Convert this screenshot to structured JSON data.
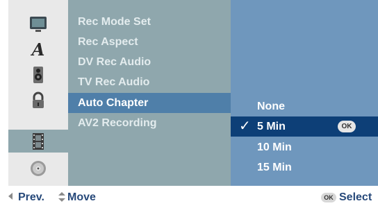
{
  "icons": [
    {
      "name": "tv-screen-icon"
    },
    {
      "name": "letter-a-icon"
    },
    {
      "name": "speaker-icon"
    },
    {
      "name": "padlock-icon"
    },
    {
      "name": "film-strip-icon"
    },
    {
      "name": "disc-icon"
    }
  ],
  "menu": {
    "items": [
      {
        "label": "Rec Mode Set"
      },
      {
        "label": "Rec Aspect"
      },
      {
        "label": "DV Rec Audio"
      },
      {
        "label": "TV Rec Audio"
      },
      {
        "label": "Auto Chapter"
      },
      {
        "label": "AV2 Recording"
      }
    ],
    "selected": "Auto Chapter"
  },
  "options": {
    "items": [
      {
        "label": "None"
      },
      {
        "label": "5 Min"
      },
      {
        "label": "10 Min"
      },
      {
        "label": "15 Min"
      }
    ],
    "selected": "5 Min",
    "checkmark": "✓",
    "ok_badge": "OK"
  },
  "footer": {
    "prev": "Prev.",
    "move": "Move",
    "ok_badge": "OK",
    "select": "Select"
  },
  "colors": {
    "menu_bg": "#8fa7ad",
    "menu_selected": "#4f7fa9",
    "options_bg": "#6f97bd",
    "option_selected": "#0d3f77",
    "footer_text": "#27497a"
  }
}
